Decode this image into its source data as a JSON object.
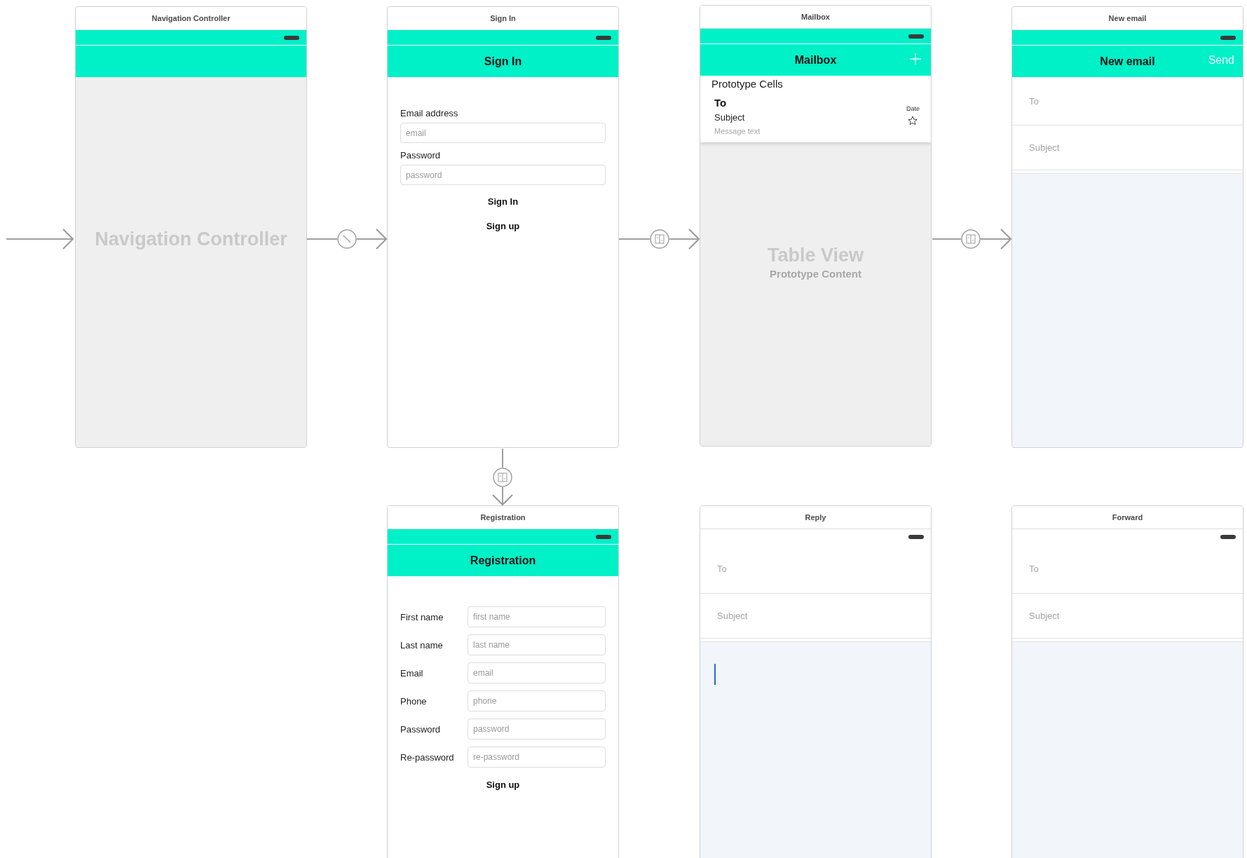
{
  "scenes": [
    {
      "kind": "navigation",
      "title": "Navigation Controller",
      "watermark": "Navigation Controller"
    },
    {
      "kind": "form",
      "title": "Sign In",
      "nav_title": "Sign In",
      "fields": [
        {
          "label": "Email address",
          "placeholder": "email"
        },
        {
          "label": "Password",
          "placeholder": "password"
        }
      ],
      "buttons": [
        "Sign In",
        "Sign up"
      ]
    },
    {
      "kind": "table",
      "title": "Mailbox",
      "nav_title": "Mailbox",
      "section": "Prototype Cells",
      "cell": {
        "to": "To",
        "subject": "Subject",
        "message": "Message text",
        "date": "Date",
        "starred": false
      },
      "watermark": "Table View",
      "watermark_sub": "Prototype Content"
    },
    {
      "kind": "compose",
      "title": "New email",
      "nav_bar": true,
      "nav_title": "New email",
      "nav_action": "Send",
      "fields": [
        {
          "placeholder": "To"
        },
        {
          "placeholder": "Subject"
        }
      ],
      "cursor": false
    },
    {
      "kind": "registration",
      "title": "Registration",
      "nav_title": "Registration",
      "fields": [
        {
          "label": "First name",
          "placeholder": "first name"
        },
        {
          "label": "Last name",
          "placeholder": "last name"
        },
        {
          "label": "Email",
          "placeholder": "email"
        },
        {
          "label": "Phone",
          "placeholder": "phone"
        },
        {
          "label": "Password",
          "placeholder": "password"
        },
        {
          "label": "Re-password",
          "placeholder": "re-password"
        }
      ],
      "buttons": [
        "Sign up"
      ]
    },
    {
      "kind": "compose",
      "title": "Reply",
      "nav_bar": false,
      "fields": [
        {
          "placeholder": "To"
        },
        {
          "placeholder": "Subject"
        }
      ],
      "cursor": true
    },
    {
      "kind": "compose",
      "title": "Forward",
      "nav_bar": false,
      "fields": [
        {
          "placeholder": "To"
        },
        {
          "placeholder": "Subject"
        }
      ],
      "cursor": false
    }
  ]
}
